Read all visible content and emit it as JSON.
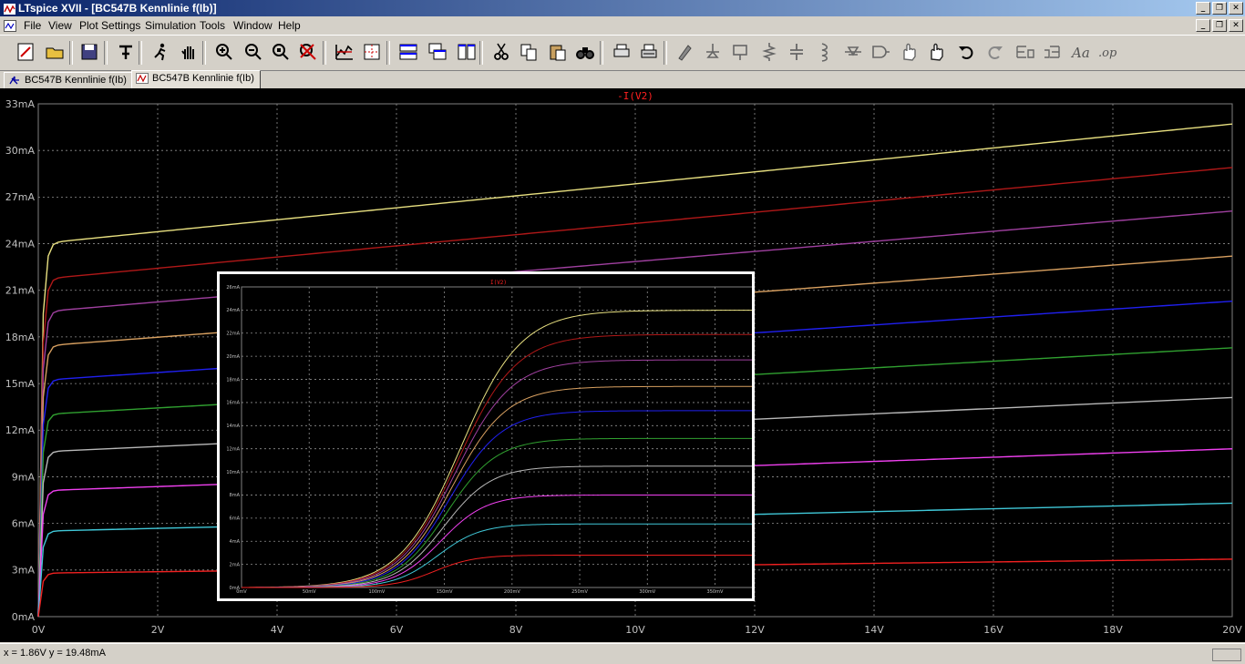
{
  "window": {
    "title": "LTspice XVII - [BC547B Kennlinie f(Ib)]",
    "controls": [
      "_",
      "❐",
      "✕"
    ]
  },
  "menu": [
    "File",
    "View",
    "Plot Settings",
    "Simulation",
    "Tools",
    "Window",
    "Help"
  ],
  "toolbar": {
    "icons": [
      "new-schematic-icon",
      "open-icon",
      "save-icon",
      "control-panel-icon",
      "run-icon",
      "halt-icon",
      "zoom-in-icon",
      "zoom-out-icon",
      "zoom-fit-icon",
      "cancel-zoom-icon",
      "autorange-icon",
      "grid-icon",
      "tile-horizontal-icon",
      "cascade-icon",
      "tile-vertical-icon",
      "cut-icon",
      "copy-icon",
      "paste-icon",
      "find-icon",
      "print-setup-icon",
      "print-icon",
      "wire-icon",
      "ground-icon",
      "label-net-icon",
      "resistor-icon",
      "capacitor-icon",
      "inductor-icon",
      "diode-icon",
      "component-icon",
      "move-icon",
      "drag-icon",
      "undo-icon",
      "redo-icon",
      "rotate-icon",
      "mirror-icon",
      "text-icon",
      "spice-directive-icon"
    ]
  },
  "tabs": [
    {
      "label": "BC547B Kennlinie f(Ib)",
      "icon": "schematic-icon"
    },
    {
      "label": "BC547B Kennlinie f(Ib)",
      "icon": "waveform-icon"
    }
  ],
  "status": {
    "coords": "x = 1.86V   y = 19.48mA"
  },
  "chart_data": [
    {
      "type": "line",
      "title": "-I(V2)",
      "xlabel": "",
      "ylabel": "",
      "xlim": [
        0,
        20
      ],
      "ylim": [
        0,
        33
      ],
      "x_ticks": [
        "0V",
        "2V",
        "4V",
        "6V",
        "8V",
        "10V",
        "12V",
        "14V",
        "16V",
        "18V",
        "20V"
      ],
      "y_ticks": [
        "0mA",
        "3mA",
        "6mA",
        "9mA",
        "12mA",
        "15mA",
        "18mA",
        "21mA",
        "24mA",
        "27mA",
        "30mA",
        "33mA"
      ],
      "grid": true,
      "x_unit": "V",
      "y_unit": "mA",
      "series": [
        {
          "color": "#e8e080",
          "sat": 24.0,
          "end": 31.7
        },
        {
          "color": "#b01818",
          "sat": 21.7,
          "end": 28.9
        },
        {
          "color": "#a040a0",
          "sat": 19.6,
          "end": 26.1
        },
        {
          "color": "#d8a060",
          "sat": 17.4,
          "end": 23.2
        },
        {
          "color": "#2020f0",
          "sat": 15.2,
          "end": 20.3
        },
        {
          "color": "#30a030",
          "sat": 13.0,
          "end": 17.3
        },
        {
          "color": "#b8b8b8",
          "sat": 10.6,
          "end": 14.1
        },
        {
          "color": "#f040f0",
          "sat": 8.1,
          "end": 10.8
        },
        {
          "color": "#40c8d8",
          "sat": 5.5,
          "end": 7.3
        },
        {
          "color": "#f02020",
          "sat": 2.8,
          "end": 3.7
        }
      ]
    },
    {
      "type": "line",
      "title": "I(V2)",
      "xlabel": "",
      "ylabel": "",
      "xlim": [
        0,
        380
      ],
      "ylim": [
        0,
        26
      ],
      "x_ticks": [
        "0mV",
        "50mV",
        "100mV",
        "150mV",
        "200mV",
        "250mV",
        "300mV",
        "350mV"
      ],
      "y_ticks": [
        "0mA",
        "2mA",
        "4mA",
        "6mA",
        "8mA",
        "10mA",
        "12mA",
        "14mA",
        "16mA",
        "18mA",
        "20mA",
        "22mA",
        "24mA",
        "26mA"
      ],
      "grid": true,
      "x_unit": "mV",
      "y_unit": "mA",
      "series": [
        {
          "color": "#e8e080",
          "sat": 24.0
        },
        {
          "color": "#b01818",
          "sat": 21.9
        },
        {
          "color": "#a040a0",
          "sat": 19.7
        },
        {
          "color": "#d8a060",
          "sat": 17.4
        },
        {
          "color": "#2020f0",
          "sat": 15.3
        },
        {
          "color": "#30a030",
          "sat": 12.9
        },
        {
          "color": "#b8b8b8",
          "sat": 10.5
        },
        {
          "color": "#f040f0",
          "sat": 8.0
        },
        {
          "color": "#40c8d8",
          "sat": 5.5
        },
        {
          "color": "#f02020",
          "sat": 2.8
        }
      ]
    }
  ]
}
